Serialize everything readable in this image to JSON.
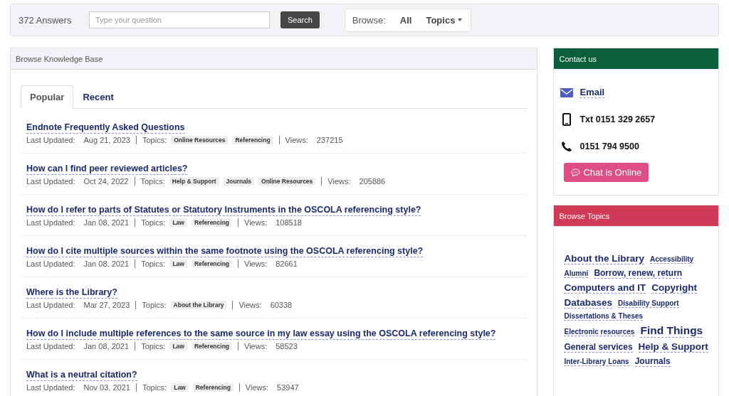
{
  "search_bar": {
    "count": "372 Answers",
    "placeholder": "Type your question",
    "button": "Search",
    "browse_label": "Browse:",
    "browse_all": "All",
    "browse_topics": "Topics"
  },
  "knowledge_base": {
    "title": "Browse Knowledge Base",
    "tabs": [
      {
        "label": "Popular",
        "selected": true
      },
      {
        "label": "Recent",
        "selected": false
      }
    ],
    "questions": [
      {
        "title": "Endnote Frequently Asked Questions",
        "updated_label": "Last Updated:",
        "updated": "Aug 21, 2023",
        "topics_label": "Topics:",
        "topics": [
          "Online Resources",
          "Referencing"
        ],
        "views_label": "Views:",
        "views": "237215"
      },
      {
        "title": "How can I find peer reviewed articles?",
        "updated_label": "Last Updated:",
        "updated": "Oct 24, 2022",
        "topics_label": "Topics:",
        "topics": [
          "Help & Support",
          "Journals",
          "Online Resources"
        ],
        "views_label": "Views:",
        "views": "205886"
      },
      {
        "title": "How do I refer to parts of Statutes or Statutory Instruments in the OSCOLA referencing style?",
        "updated_label": "Last Updated:",
        "updated": "Jan 08, 2021",
        "topics_label": "Topics:",
        "topics": [
          "Law",
          "Referencing"
        ],
        "views_label": "Views:",
        "views": "108518"
      },
      {
        "title": "How do I cite multiple sources within the same footnote using the OSCOLA referencing style?",
        "updated_label": "Last Updated:",
        "updated": "Jan 08, 2021",
        "topics_label": "Topics:",
        "topics": [
          "Law",
          "Referencing"
        ],
        "views_label": "Views:",
        "views": "82661"
      },
      {
        "title": "Where is the Library?",
        "updated_label": "Last Updated:",
        "updated": "Mar 27, 2023",
        "topics_label": "Topics:",
        "topics": [
          "About the Library"
        ],
        "views_label": "Views:",
        "views": "60338"
      },
      {
        "title": "How do I include multiple references to the same source in my law essay using the OSCOLA referencing style?",
        "updated_label": "Last Updated:",
        "updated": "Jan 08, 2021",
        "topics_label": "Topics:",
        "topics": [
          "Law",
          "Referencing"
        ],
        "views_label": "Views:",
        "views": "58523"
      },
      {
        "title": "What is a neutral citation?",
        "updated_label": "Last Updated:",
        "updated": "Nov 03, 2021",
        "topics_label": "Topics:",
        "topics": [
          "Law",
          "Referencing"
        ],
        "views_label": "Views:",
        "views": "53947"
      }
    ]
  },
  "contact": {
    "title": "Contact us",
    "items": [
      {
        "kind": "email",
        "text": "Email"
      },
      {
        "kind": "mobile",
        "text": "Txt 0151 329 2657"
      },
      {
        "kind": "phone",
        "text": "0151 794 9500"
      }
    ],
    "chat_button": "Chat is Online"
  },
  "browse_topics": {
    "title": "Browse Topics",
    "topics": [
      {
        "label": "About the Library",
        "kind": "large"
      },
      {
        "label": "Accessibility",
        "kind": "small"
      },
      {
        "label": "Alumni",
        "kind": "small"
      },
      {
        "label": "Borrow, renew, return",
        "kind": "medium"
      },
      {
        "label": "Computers and IT",
        "kind": "large"
      },
      {
        "label": "Copyright",
        "kind": "large"
      },
      {
        "label": "Databases",
        "kind": "large"
      },
      {
        "label": "Disability Support",
        "kind": "small"
      },
      {
        "label": "Dissertations & Theses",
        "kind": "small"
      },
      {
        "label": "Electronic resources",
        "kind": "small"
      },
      {
        "label": "Find Things",
        "kind": "xlarge"
      },
      {
        "label": "General services",
        "kind": "medium"
      },
      {
        "label": "Help & Support",
        "kind": "large"
      },
      {
        "label": "Inter-Library Loans",
        "kind": "small"
      },
      {
        "label": "Journals",
        "kind": "medium"
      }
    ]
  }
}
